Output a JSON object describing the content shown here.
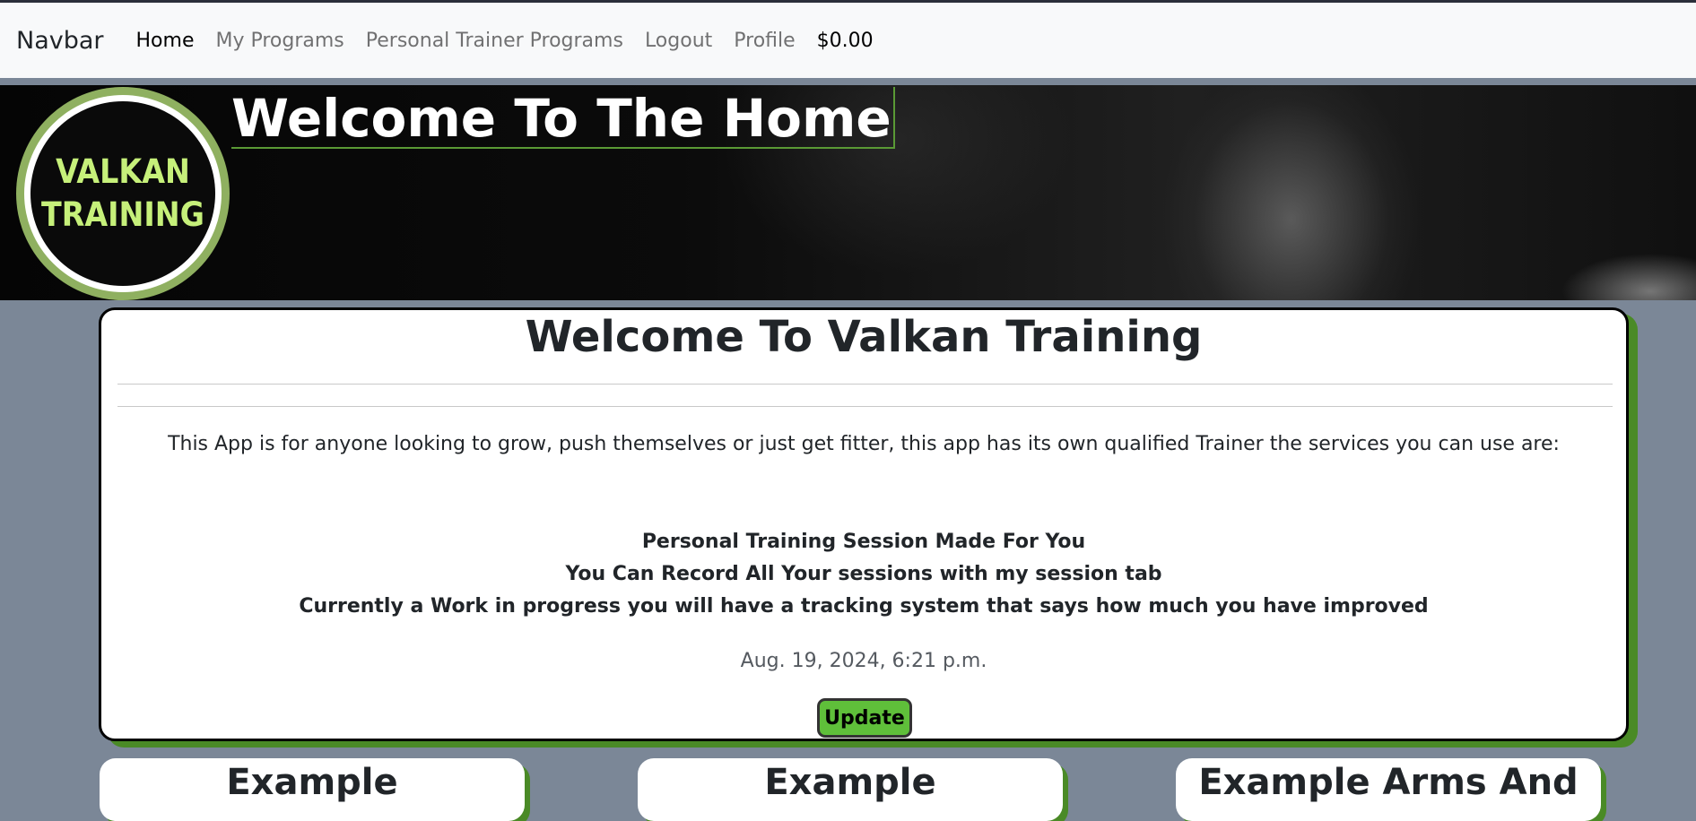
{
  "navbar": {
    "brand": "Navbar",
    "links": [
      "Home",
      "My Programs",
      "Personal Trainer Programs",
      "Logout",
      "Profile"
    ],
    "amount": "$0.00"
  },
  "hero": {
    "logo_line1": "VALKAN",
    "logo_line2": "TRAINING",
    "title": "Welcome To The Home"
  },
  "card": {
    "title": "Welcome To Valkan Training",
    "description": "This App is for anyone looking to grow, push themselves or just get fitter, this app has its own qualified Trainer the services you can use are:",
    "features": [
      "Personal Training Session Made For You",
      "You Can Record All Your sessions with my session tab",
      "Currently a Work in progress you will have a tracking system that says how much you have improved"
    ],
    "date": "Aug. 19, 2024, 6:21 p.m.",
    "update_label": "Update"
  },
  "programs": [
    {
      "title": "Example"
    },
    {
      "title": "Example"
    },
    {
      "title": "Example Arms And"
    }
  ],
  "colors": {
    "accent_green": "#4a8a26",
    "button_green": "#5fbf3a",
    "logo_text": "#c6f07a",
    "page_bg": "#7b8797"
  }
}
